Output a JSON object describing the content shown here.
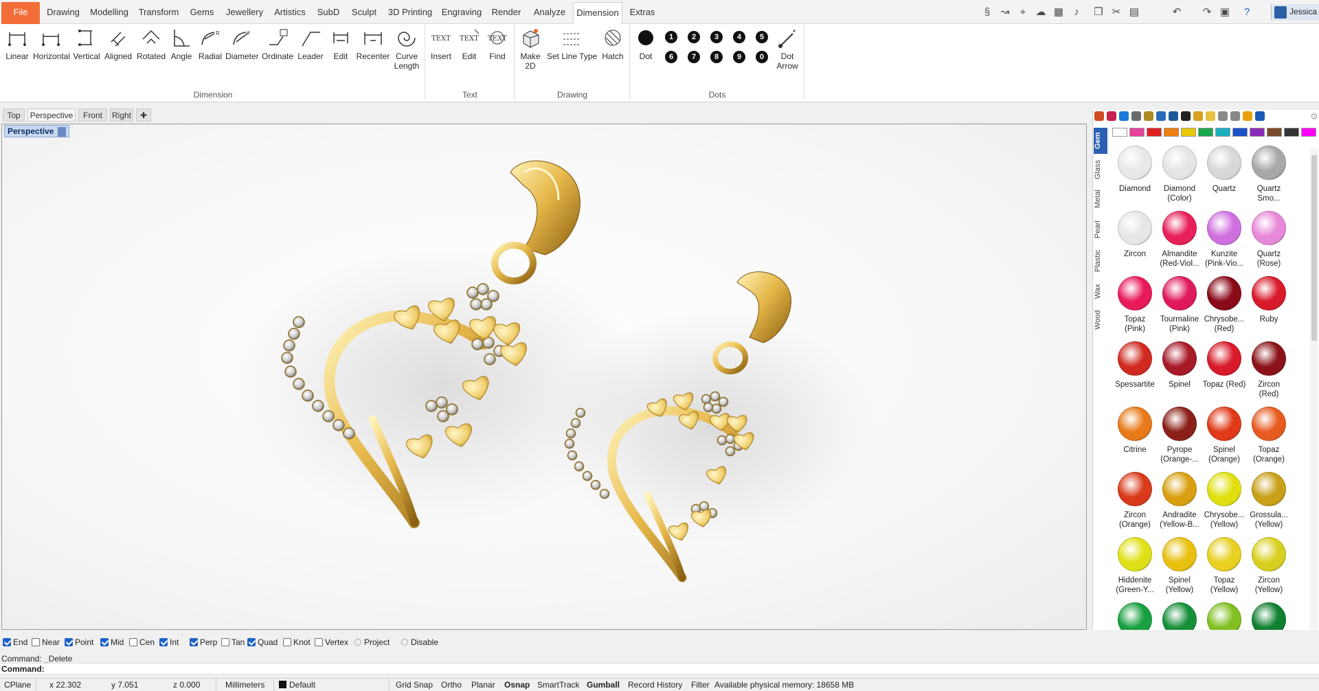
{
  "menu": {
    "tabs": [
      "File",
      "Drawing",
      "Modelling",
      "Transform",
      "Gems",
      "Jewellery",
      "Artistics",
      "SubD",
      "Sculpt",
      "3D Printing",
      "Engraving",
      "Render",
      "Analyze",
      "Dimension",
      "Extras"
    ],
    "active": "Dimension",
    "user": "Jessica"
  },
  "ribbon": {
    "groups": {
      "dimension": "Dimension",
      "text": "Text",
      "drawing": "Drawing",
      "dots": "Dots"
    },
    "tools": {
      "linear": "Linear",
      "horizontal": "Horizontal",
      "vertical": "Vertical",
      "aligned": "Aligned",
      "rotated": "Rotated",
      "angle": "Angle",
      "radial": "Radial",
      "diameter": "Diameter",
      "ordinate": "Ordinate",
      "leader": "Leader",
      "edit": "Edit",
      "recenter": "Recenter",
      "curve_length_1": "Curve",
      "curve_length_2": "Length",
      "insert": "Insert",
      "text_edit": "Edit",
      "find": "Find",
      "make2d_1": "Make",
      "make2d_2": "2D",
      "set_line_type": "Set Line Type",
      "hatch": "Hatch",
      "dot": "Dot",
      "dot_arrow_1": "Dot",
      "dot_arrow_2": "Arrow"
    },
    "icon_texts": {
      "text": "TEXT",
      "text_edit": "TEXT",
      "find": "TEXT"
    },
    "dot_numbers": [
      "1",
      "2",
      "3",
      "4",
      "5",
      "6",
      "7",
      "8",
      "9",
      "0"
    ]
  },
  "viewport": {
    "tabs": [
      "Top",
      "Perspective",
      "Front",
      "Right"
    ],
    "active_tab": "Perspective",
    "label": "Perspective"
  },
  "panel": {
    "side_tabs": [
      "Gem",
      "Glass",
      "Metal",
      "Pearl",
      "Plastic",
      "Wax",
      "Wood"
    ],
    "active_side_tab": "Gem",
    "swatches": [
      "#ffffff",
      "#e8409a",
      "#e02020",
      "#f07d10",
      "#e8c800",
      "#1aa64a",
      "#1ab0c0",
      "#1a50c8",
      "#8a2ab8",
      "#7a4a2a",
      "#333333",
      "#ff00ff"
    ],
    "gems": [
      {
        "l1": "Diamond",
        "l2": "",
        "c": "#e8e8e8"
      },
      {
        "l1": "Diamond",
        "l2": "(Color)",
        "c": "#e4e4e4"
      },
      {
        "l1": "Quartz",
        "l2": "",
        "c": "#d8d8d8"
      },
      {
        "l1": "Quartz",
        "l2": "Smo...",
        "c": "#a8a8a8"
      },
      {
        "l1": "Zircon",
        "l2": "",
        "c": "#e6e6e6"
      },
      {
        "l1": "Almandite",
        "l2": "(Red-Viol...",
        "c": "#e8205a"
      },
      {
        "l1": "Kunzite",
        "l2": "(Pink-Vio...",
        "c": "#d070e0"
      },
      {
        "l1": "Quartz",
        "l2": "(Rose)",
        "c": "#e888d8"
      },
      {
        "l1": "Topaz",
        "l2": "(Pink)",
        "c": "#e81a5a"
      },
      {
        "l1": "Tourmaline",
        "l2": "(Pink)",
        "c": "#e01a5a"
      },
      {
        "l1": "Chrysobe...",
        "l2": "(Red)",
        "c": "#8a0a18"
      },
      {
        "l1": "Ruby",
        "l2": "",
        "c": "#d81a2a"
      },
      {
        "l1": "Spessartite",
        "l2": "",
        "c": "#d02a20"
      },
      {
        "l1": "Spinel",
        "l2": "",
        "c": "#a81a28"
      },
      {
        "l1": "Topaz (Red)",
        "l2": "",
        "c": "#d81a2a"
      },
      {
        "l1": "Zircon",
        "l2": "(Red)",
        "c": "#8a1218"
      },
      {
        "l1": "Citrine",
        "l2": "",
        "c": "#e87a1a"
      },
      {
        "l1": "Pyrope",
        "l2": "(Orange-...",
        "c": "#8a2018"
      },
      {
        "l1": "Spinel",
        "l2": "(Orange)",
        "c": "#e03a18"
      },
      {
        "l1": "Topaz",
        "l2": "(Orange)",
        "c": "#e85a20"
      },
      {
        "l1": "Zircon",
        "l2": "(Orange)",
        "c": "#d83a1a"
      },
      {
        "l1": "Andradite",
        "l2": "(Yellow-B...",
        "c": "#d8a010"
      },
      {
        "l1": "Chrysobe...",
        "l2": "(Yellow)",
        "c": "#e0e010"
      },
      {
        "l1": "Grossula...",
        "l2": "(Yellow)",
        "c": "#c8a018"
      },
      {
        "l1": "Hiddenite",
        "l2": "(Green-Y...",
        "c": "#e0e018"
      },
      {
        "l1": "Spinel",
        "l2": "(Yellow)",
        "c": "#e8c010"
      },
      {
        "l1": "Topaz",
        "l2": "(Yellow)",
        "c": "#e8d020"
      },
      {
        "l1": "Zircon",
        "l2": "(Yellow)",
        "c": "#d8d020"
      },
      {
        "l1": "",
        "l2": "",
        "c": "#18a040"
      },
      {
        "l1": "",
        "l2": "",
        "c": "#18903a"
      },
      {
        "l1": "",
        "l2": "",
        "c": "#80c020"
      },
      {
        "l1": "",
        "l2": "",
        "c": "#108030"
      }
    ]
  },
  "osnap": {
    "items": [
      {
        "label": "End",
        "on": true
      },
      {
        "label": "Near",
        "on": false
      },
      {
        "label": "Point",
        "on": true
      },
      {
        "label": "Mid",
        "on": true
      },
      {
        "label": "Cen",
        "on": false
      },
      {
        "label": "Int",
        "on": true
      },
      {
        "label": "Perp",
        "on": true
      },
      {
        "label": "Tan",
        "on": false
      },
      {
        "label": "Quad",
        "on": true
      },
      {
        "label": "Knot",
        "on": false
      },
      {
        "label": "Vertex",
        "on": false
      }
    ],
    "project": "Project",
    "disable": "Disable"
  },
  "command": {
    "history": "Command: _Delete",
    "prompt": "Command:",
    "value": ""
  },
  "status": {
    "cplane": "CPlane",
    "x": "x 22.302",
    "y": "y 7.051",
    "z": "z 0.000",
    "units": "Millimeters",
    "layer": "Default",
    "grid_snap": "Grid Snap",
    "ortho": "Ortho",
    "planar": "Planar",
    "osnap": "Osnap",
    "smarttrack": "SmartTrack",
    "gumball": "Gumball",
    "record_history": "Record History",
    "filter": "Filter",
    "memory": "Available physical memory: 18658 MB"
  }
}
